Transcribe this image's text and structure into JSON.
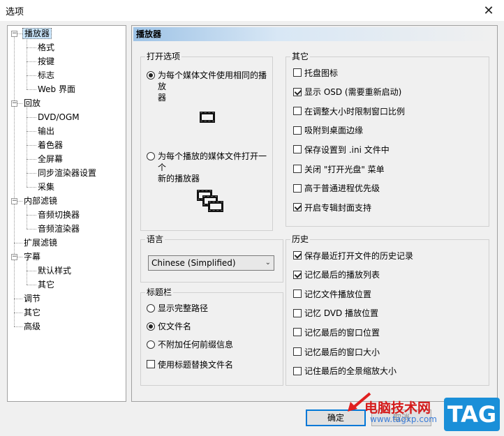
{
  "window": {
    "title": "选项",
    "close_glyph": "✕"
  },
  "tree": [
    {
      "label": "播放器",
      "level": 0,
      "expander": "−",
      "selected": true
    },
    {
      "label": "格式",
      "level": 1
    },
    {
      "label": "按键",
      "level": 1
    },
    {
      "label": "标志",
      "level": 1
    },
    {
      "label": "Web 界面",
      "level": 1
    },
    {
      "label": "回放",
      "level": 0,
      "expander": "−"
    },
    {
      "label": "DVD/OGM",
      "level": 1
    },
    {
      "label": "输出",
      "level": 1
    },
    {
      "label": "着色器",
      "level": 1
    },
    {
      "label": "全屏幕",
      "level": 1
    },
    {
      "label": "同步渲染器设置",
      "level": 1
    },
    {
      "label": "采集",
      "level": 1
    },
    {
      "label": "内部滤镜",
      "level": 0,
      "expander": "−"
    },
    {
      "label": "音频切换器",
      "level": 1
    },
    {
      "label": "音频渲染器",
      "level": 1
    },
    {
      "label": "扩展滤镜",
      "level": 0
    },
    {
      "label": "字幕",
      "level": 0,
      "expander": "−"
    },
    {
      "label": "默认样式",
      "level": 1
    },
    {
      "label": "其它",
      "level": 1
    },
    {
      "label": "调节",
      "level": 0
    },
    {
      "label": "其它",
      "level": 0
    },
    {
      "label": "高级",
      "level": 0
    }
  ],
  "panel": {
    "title": "播放器"
  },
  "open_options": {
    "label": "打开选项",
    "option_same_line1": "为每个媒体文件使用相同的播放",
    "option_same_line2": "器",
    "option_new_line1": "为每个播放的媒体文件打开一个",
    "option_new_line2": "新的播放器",
    "selected": "same"
  },
  "other": {
    "label": "其它",
    "items": [
      {
        "label": "托盘图标",
        "checked": false
      },
      {
        "label": "显示 OSD (需要重新启动)",
        "checked": true
      },
      {
        "label": "在调整大小时限制窗口比例",
        "checked": false
      },
      {
        "label": "吸附到桌面边缘",
        "checked": false
      },
      {
        "label": "保存设置到 .ini 文件中",
        "checked": false
      },
      {
        "label": "关闭 \"打开光盘\" 菜单",
        "checked": false
      },
      {
        "label": "高于普通进程优先级",
        "checked": false
      },
      {
        "label": "开启专辑封面支持",
        "checked": true
      }
    ]
  },
  "language": {
    "label": "语言",
    "value": "Chinese (Simplified)",
    "arrow": "⌄"
  },
  "titlebar_group": {
    "label": "标题栏",
    "options": [
      {
        "label": "显示完整路径",
        "selected": false
      },
      {
        "label": "仅文件名",
        "selected": true
      },
      {
        "label": "不附加任何前缀信息",
        "selected": false
      }
    ],
    "checkbox": {
      "label": "使用标题替换文件名",
      "checked": false
    }
  },
  "history": {
    "label": "历史",
    "items": [
      {
        "label": "保存最近打开文件的历史记录",
        "checked": true
      },
      {
        "label": "记忆最后的播放列表",
        "checked": true
      },
      {
        "label": "记忆文件播放位置",
        "checked": false
      },
      {
        "label": "记忆 DVD 播放位置",
        "checked": false
      },
      {
        "label": "记忆最后的窗口位置",
        "checked": false
      },
      {
        "label": "记忆最后的窗口大小",
        "checked": false
      },
      {
        "label": "记住最后的全景缩放大小",
        "checked": false
      }
    ]
  },
  "buttons": {
    "ok": "确定",
    "cancel": "取消"
  },
  "watermark": {
    "site": "电脑技术网",
    "url": "www.tagxp.com",
    "logo": "TAG"
  }
}
